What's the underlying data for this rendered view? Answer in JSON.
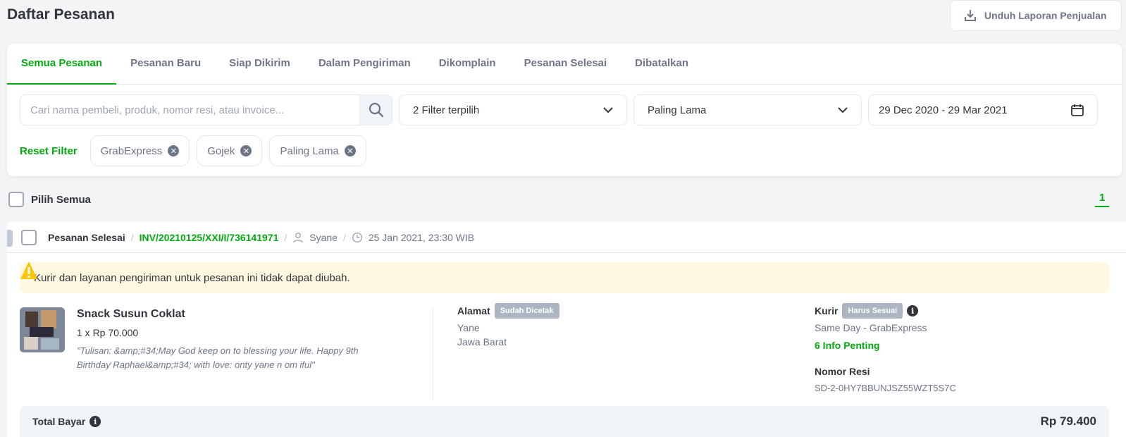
{
  "page": {
    "title": "Daftar Pesanan",
    "download_label": "Unduh Laporan Penjualan"
  },
  "tabs": [
    {
      "label": "Semua Pesanan",
      "active": true
    },
    {
      "label": "Pesanan Baru"
    },
    {
      "label": "Siap Dikirim"
    },
    {
      "label": "Dalam Pengiriman"
    },
    {
      "label": "Dikomplain"
    },
    {
      "label": "Pesanan Selesai"
    },
    {
      "label": "Dibatalkan"
    }
  ],
  "filters": {
    "search_placeholder": "Cari nama pembeli, produk, nomor resi, atau invoice...",
    "filter_select": "2 Filter terpilih",
    "sort_select": "Paling Lama",
    "date_range": "29 Dec 2020 - 29 Mar 2021",
    "reset_label": "Reset Filter",
    "chips": [
      "GrabExpress",
      "Gojek",
      "Paling Lama"
    ]
  },
  "list": {
    "select_all_label": "Pilih Semua",
    "page_number": "1"
  },
  "order": {
    "status": "Pesanan Selesai",
    "invoice": "INV/20210125/XXI/I/736141971",
    "buyer": "Syane",
    "datetime": "25 Jan 2021, 23:30 WIB",
    "warning": "Kurir dan layanan pengiriman untuk pesanan ini tidak dapat diubah.",
    "product_name": "Snack Susun Coklat",
    "product_qty": "1 x Rp 70.000",
    "product_note": "\"Tulisan: &amp;#34;May God keep on to blessing your life. Happy 9th Birthday Raphael&amp;#34; with love: onty yane n om iful\"",
    "address_label": "Alamat",
    "address_badge": "Sudah Dicetak",
    "address_name": "Yane",
    "address_region": "Jawa Barat",
    "courier_label": "Kurir",
    "courier_badge": "Harus Sesuai",
    "courier_service": "Same Day - GrabExpress",
    "info_penting": "6 Info Penting",
    "resi_label": "Nomor Resi",
    "resi_value": "SD-2-0HY7BBUNJSZ55WZT5S7C",
    "total_label": "Total Bayar",
    "total_value": "Rp 79.400"
  },
  "colors": {
    "accent_green": "#03ac0e",
    "warning_bg": "#fff8e0",
    "badge_gray": "#adb5c2"
  }
}
